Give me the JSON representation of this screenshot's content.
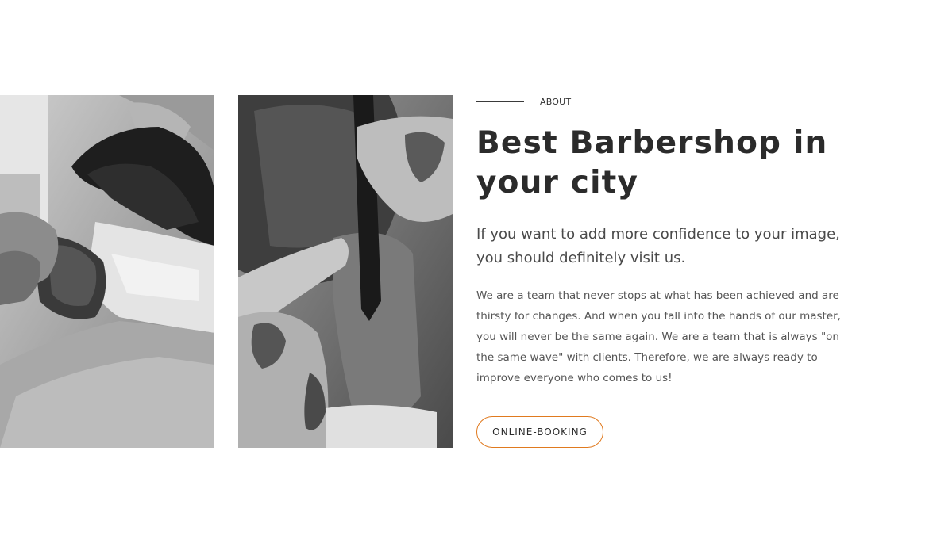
{
  "about": {
    "eyebrow": "ABOUT",
    "title": "Best Barbershop in your city",
    "lead": "If you want to add more confidence to your image, you should definitely visit us.",
    "body": "We are a team that never stops at what has been achieved and are thirsty for changes. And when you fall into the hands of our master, you will never be the same again. We are a team that is always \"on the same wave\" with clients. Therefore, we are always ready to improve everyone who comes to us!",
    "button_label": "ONLINE-BOOKING"
  },
  "images": [
    {
      "name": "beard-brush-photo",
      "subject": "barber brushing shaving foam onto a bearded client"
    },
    {
      "name": "razor-haircut-photo",
      "subject": "tattooed barber trimming hair with a straight razor"
    }
  ],
  "colors": {
    "accent": "#e07a1f",
    "heading": "#2b2b2b",
    "text": "#555555",
    "background": "#ffffff"
  }
}
